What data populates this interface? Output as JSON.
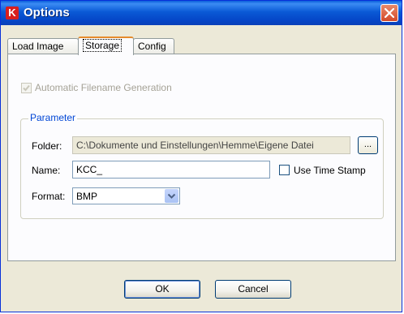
{
  "window": {
    "title": "Options",
    "app_icon_letter": "K"
  },
  "tabs": [
    {
      "label": "Load Image",
      "active": false
    },
    {
      "label": "Storage",
      "active": true
    },
    {
      "label": "Config",
      "active": false
    }
  ],
  "storage": {
    "auto_filename": {
      "label": "Automatic Filename Generation",
      "checked": true,
      "enabled": false
    },
    "parameter_group": {
      "title": "Parameter",
      "folder": {
        "label": "Folder:",
        "value": "C:\\Dokumente und Einstellungen\\Hemme\\Eigene Datei",
        "browse_label": "..."
      },
      "name": {
        "label": "Name:",
        "value": "KCC_"
      },
      "use_time_stamp": {
        "label": "Use Time Stamp",
        "checked": false
      },
      "format": {
        "label": "Format:",
        "value": "BMP"
      }
    }
  },
  "buttons": {
    "ok": "OK",
    "cancel": "Cancel"
  },
  "colors": {
    "titlebar": "#0a5ad6",
    "tab_highlight": "#e68b2c",
    "group_title": "#0046d5",
    "close_button": "#d34a2a"
  }
}
